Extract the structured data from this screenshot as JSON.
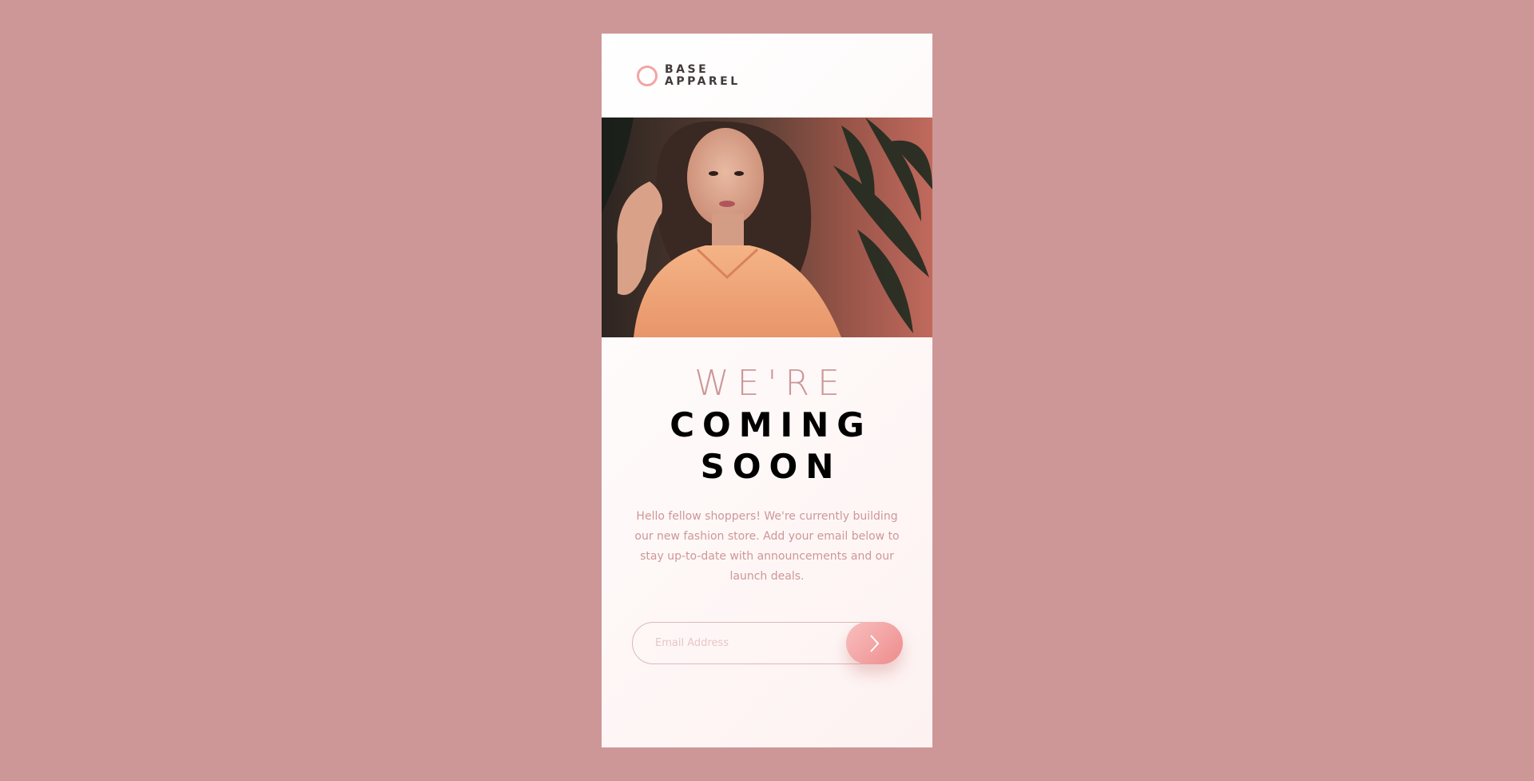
{
  "brand": {
    "line1": "BASE",
    "line2": "APPAREL",
    "accent_color": "#f3a4a4"
  },
  "hero_image": {
    "description_icon": "woman-portrait-photo"
  },
  "headline": {
    "light": "WE'RE",
    "bold_line1": "COMING",
    "bold_line2": "SOON"
  },
  "description": "Hello fellow shoppers! We're currently building our new fashion store. Add your email below to stay up-to-date with announcements and our launch deals.",
  "form": {
    "email_placeholder": "Email Address",
    "submit_icon": "chevron-right-icon"
  },
  "colors": {
    "background": "#ce9797",
    "desaturated_red": "#ce9797",
    "dark_grayish_red": "#423a3a",
    "button_gradient_start": "#f8bfbf",
    "button_gradient_end": "#ee8c8c"
  }
}
